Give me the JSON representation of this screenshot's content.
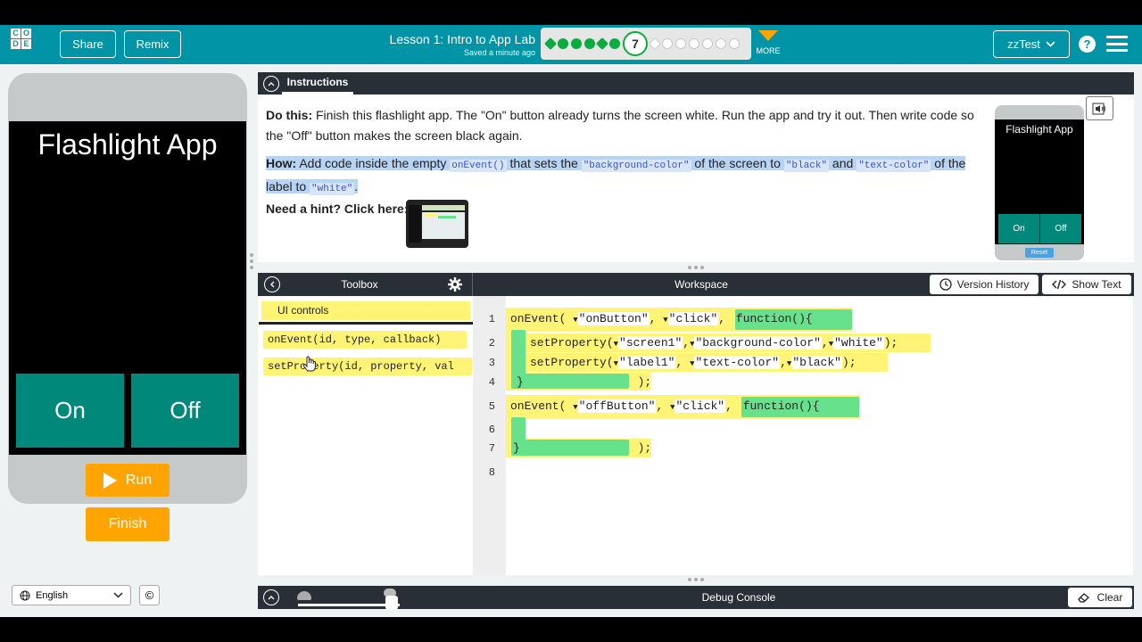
{
  "header": {
    "logo_letters": [
      "C",
      "O",
      "D",
      "E"
    ],
    "share_label": "Share",
    "remix_label": "Remix",
    "lesson_title": "Lesson 1: Intro to App Lab",
    "saved_status": "Saved a minute ago",
    "current_level": "7",
    "more_label": "MORE",
    "user_name": "zzTest",
    "help_label": "?"
  },
  "app": {
    "title": "Flashlight App",
    "on_label": "On",
    "off_label": "Off",
    "run_label": "Run",
    "finish_label": "Finish"
  },
  "footer": {
    "language": "English",
    "copyright": "©"
  },
  "instructions": {
    "tab_label": "Instructions",
    "do_this_label": "Do this:",
    "do_this_text": " Finish this flashlight app. The \"On\" button already turns the screen white. Run the app and try it out. Then write code so the \"Off\" button makes the screen black again.",
    "how_label": "How:",
    "how_t1": " Add code inside the empty ",
    "how_c1": "onEvent()",
    "how_t2": " that sets the ",
    "how_c2": "\"background-color\"",
    "how_t3": " of the screen to ",
    "how_c3": "\"black\"",
    "how_t4": " and ",
    "how_c4": "\"text-color\"",
    "how_t5": " of the label to ",
    "how_c5": "\"white\"",
    "how_t6": ".",
    "hint_label": "Need a hint? Click here:",
    "mini_title": "Flashlight App",
    "mini_on": "On",
    "mini_off": "Off",
    "mini_reset": "Reset"
  },
  "toolbox": {
    "title": "Toolbox",
    "category": "UI controls",
    "blocks": [
      "onEvent(id, type, callback)",
      "setProperty(id, property, val"
    ]
  },
  "workspace": {
    "title": "Workspace",
    "version_history_label": "Version History",
    "show_text_label": "Show Text",
    "line_numbers": [
      "1",
      "2",
      "3",
      "4",
      "5",
      "6",
      "7",
      "8"
    ],
    "lines": {
      "l1_fn": "onEvent(",
      "l1_a1": "\"onButton\"",
      "l1_a2": "\"click\"",
      "l1_func": "function(){",
      "l2_fn": "setProperty(",
      "l2_a1": "\"screen1\"",
      "l2_a2": "\"background-color\"",
      "l2_a3": "\"white\"",
      "l3_fn": "setProperty(",
      "l3_a1": "\"label1\"",
      "l3_a2": "\"text-color\"",
      "l3_a3": "\"black\"",
      "l4_close": "}",
      "l4_end": ");",
      "l5_fn": "onEvent(",
      "l5_a1": "\"offButton\"",
      "l5_a2": "\"click\"",
      "l5_func": "function(){",
      "l7_close": "}",
      "l7_end": ");"
    }
  },
  "debug": {
    "title": "Debug Console",
    "clear_label": "Clear"
  },
  "colors": {
    "header_teal": "#0094a6",
    "app_button_teal": "#00897b",
    "run_orange": "#ffa400",
    "block_yellow": "#fff476",
    "block_green": "#68e18c",
    "dark_bar": "#292f36"
  }
}
